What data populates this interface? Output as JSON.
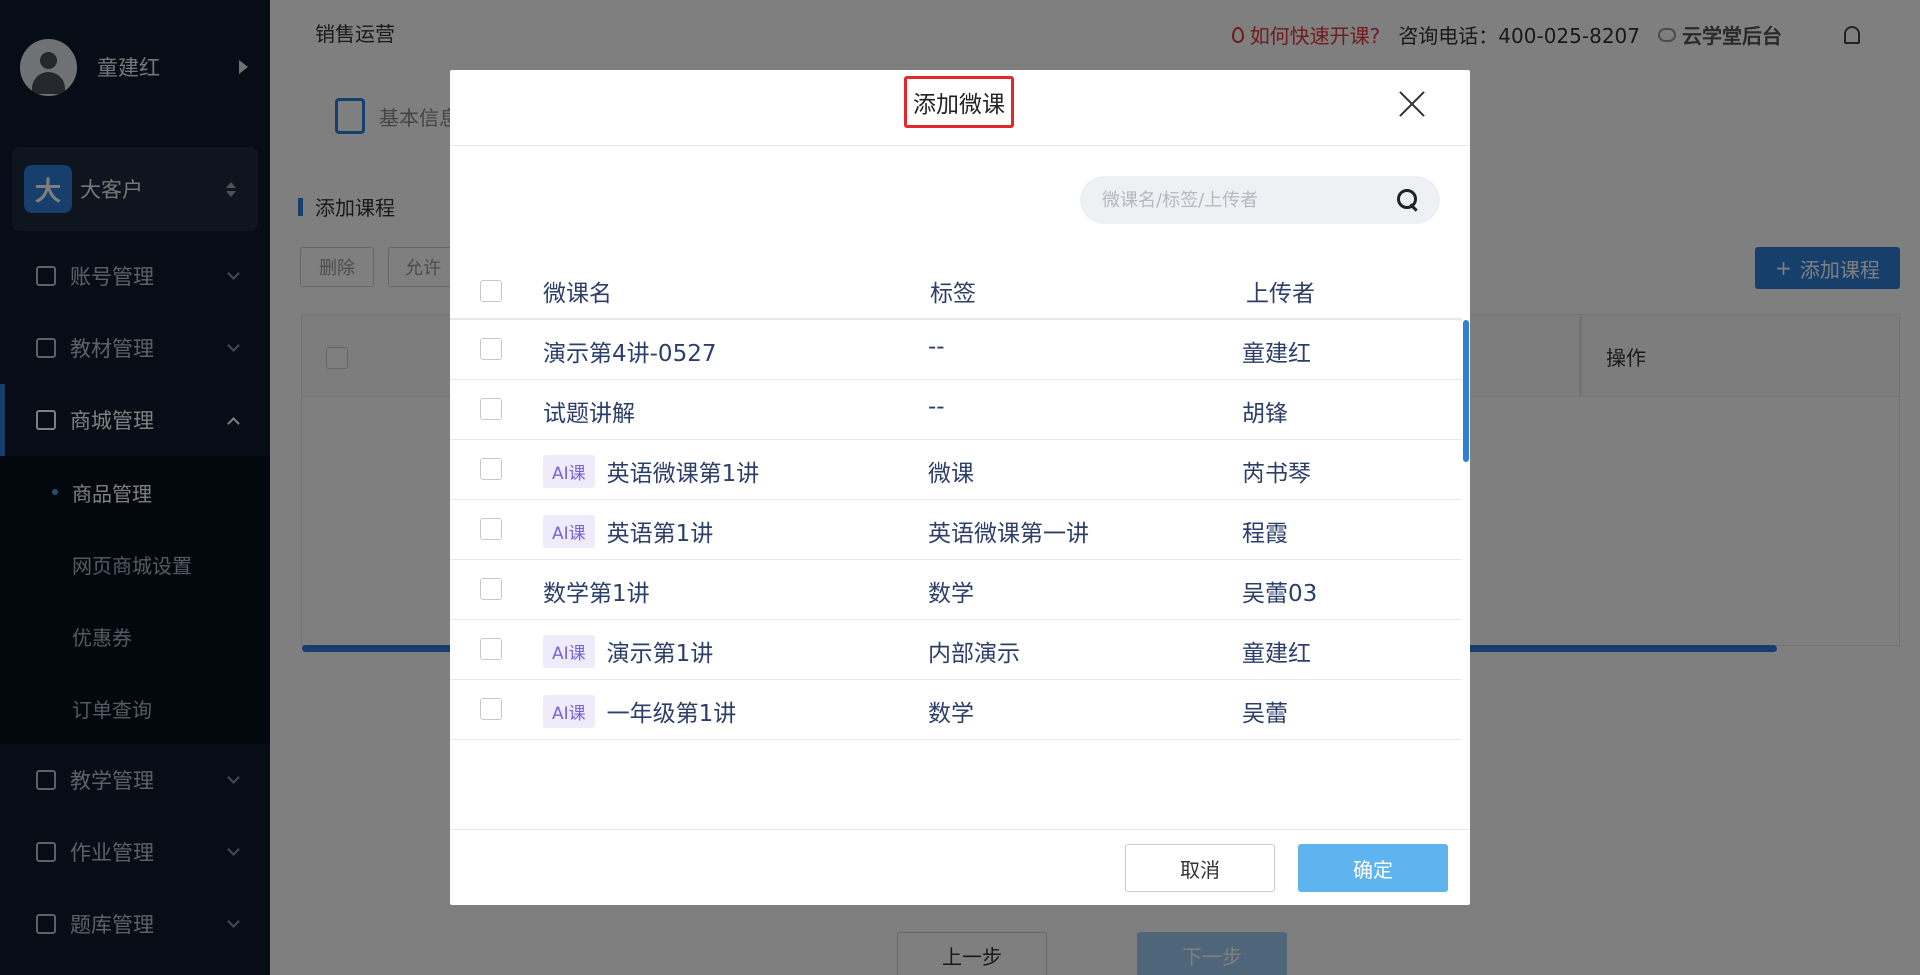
{
  "sidebar": {
    "user_name": "童建红",
    "tenant_badge": "大",
    "tenant_name": "大客户",
    "menu": [
      {
        "label": "账号管理"
      },
      {
        "label": "教材管理"
      },
      {
        "label": "商城管理"
      },
      {
        "label": "教学管理"
      },
      {
        "label": "作业管理"
      },
      {
        "label": "题库管理"
      }
    ],
    "submenu": [
      {
        "label": "商品管理"
      },
      {
        "label": "网页商城设置"
      },
      {
        "label": "优惠券"
      },
      {
        "label": "订单查询"
      }
    ]
  },
  "topbar": {
    "page_title": "销售运营",
    "quick_link": "如何快速开课?",
    "phone": "咨询电话：400-025-8207",
    "brand": "云学堂后台"
  },
  "background": {
    "step_tab": "基本信息",
    "section_title": "添加课程",
    "delete_btn": "删除",
    "allow_btn": "允许",
    "add_course_btn": "添加课程",
    "op_header": "操作",
    "prev_btn": "上一步",
    "next_btn": "下一步"
  },
  "modal": {
    "title": "添加微课",
    "search_placeholder": "微课名/标签/上传者",
    "columns": {
      "name": "微课名",
      "tag": "标签",
      "uploader": "上传者"
    },
    "ai_badge": "AI课",
    "rows": [
      {
        "name": "演示第4讲-0527",
        "ai": false,
        "tag": "--",
        "uploader": "童建红"
      },
      {
        "name": "试题讲解",
        "ai": false,
        "tag": "--",
        "uploader": "胡锋"
      },
      {
        "name": "英语微课第1讲",
        "ai": true,
        "tag": "微课",
        "uploader": "芮书琴"
      },
      {
        "name": "英语第1讲",
        "ai": true,
        "tag": "英语微课第一讲",
        "uploader": "程霞"
      },
      {
        "name": "数学第1讲",
        "ai": false,
        "tag": "数学",
        "uploader": "吴蕾03"
      },
      {
        "name": "演示第1讲",
        "ai": true,
        "tag": "内部演示",
        "uploader": "童建红"
      },
      {
        "name": "一年级第1讲",
        "ai": true,
        "tag": "数学",
        "uploader": "吴蕾"
      }
    ],
    "cancel": "取消",
    "confirm": "确定"
  }
}
